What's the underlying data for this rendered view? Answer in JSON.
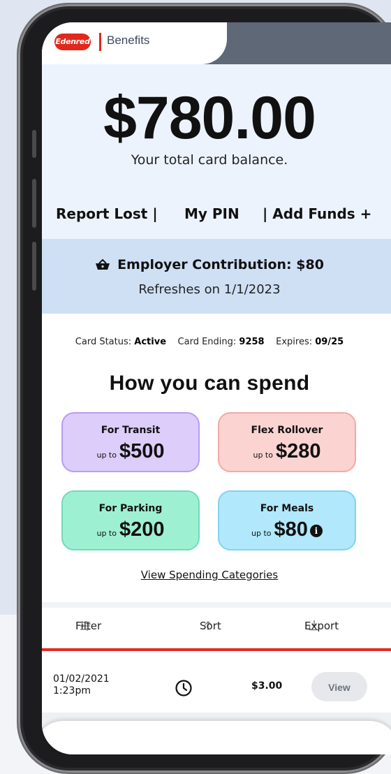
{
  "brand": {
    "logo_text": "Edenred",
    "product": "Benefits",
    "accent": "#e0281c"
  },
  "balance": {
    "amount": "$780.00",
    "label": "Your total card balance."
  },
  "actions": {
    "report_lost": "Report Lost  |",
    "my_pin": "My PIN",
    "add_funds": "| Add Funds +"
  },
  "contribution": {
    "icon": "basket-icon",
    "title": "Employer Contribution: $80",
    "refresh": "Refreshes on 1/1/2023"
  },
  "card_status": {
    "status_label": "Card Status:",
    "status_value": "Active",
    "ending_label": "Card Ending:",
    "ending_value": "9258",
    "expires_label": "Expires:",
    "expires_value": "09/25"
  },
  "spend": {
    "title": "How you can spend",
    "cards": [
      {
        "title": "For Transit",
        "prefix": "up to",
        "amount": "$500",
        "color": "#dccdfb"
      },
      {
        "title": "Flex Rollover",
        "prefix": "up to",
        "amount": "$280",
        "color": "#fbd3d0"
      },
      {
        "title": "For Parking",
        "prefix": "up to",
        "amount": "$200",
        "color": "#9ef0d3"
      },
      {
        "title": "For Meals",
        "prefix": "up to",
        "amount": "$80",
        "color": "#b1e8fb",
        "info_icon": "info-icon"
      }
    ],
    "view_categories": "View Spending Categories"
  },
  "toolbar": {
    "filter": "Filter",
    "sort": "Sort",
    "export": "Export"
  },
  "transaction": {
    "date": "01/02/2021",
    "time": "1:23pm",
    "icon": "clock-icon",
    "amount": "$3.00",
    "view_label": "View"
  }
}
